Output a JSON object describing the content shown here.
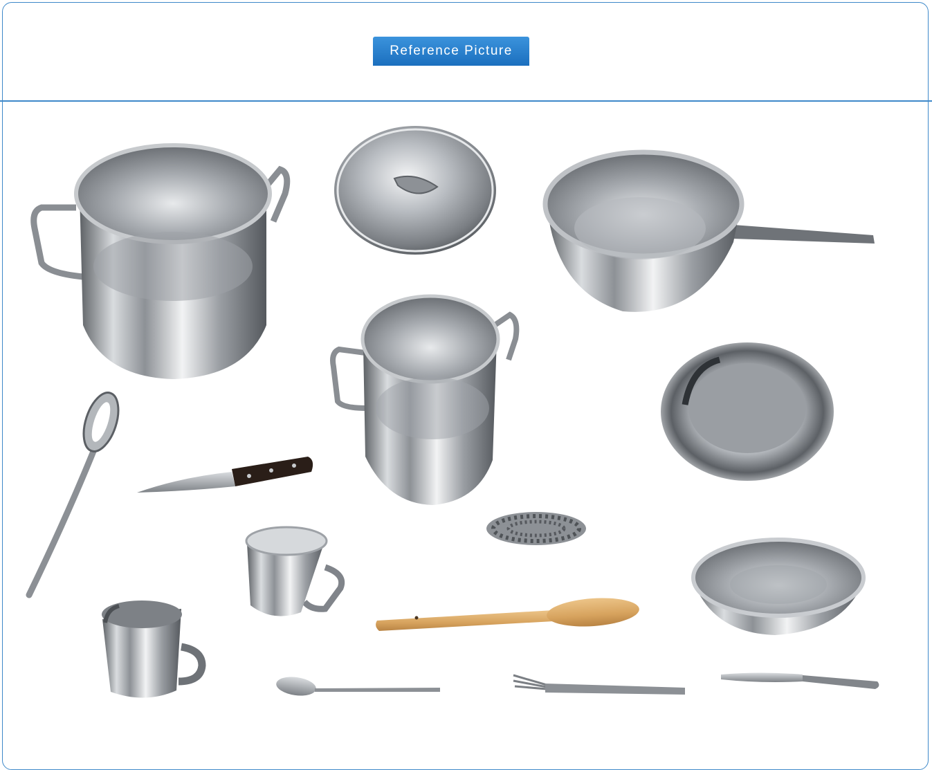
{
  "header": {
    "label": "Reference Picture"
  },
  "items": [
    "large-stock-pot",
    "pot-lid",
    "frying-pan",
    "medium-stock-pot",
    "slotted-serving-spoon",
    "kitchen-knife",
    "plate",
    "steel-wool-scrubber",
    "small-cup",
    "wooden-spoon",
    "bowl",
    "mug",
    "teaspoon",
    "fork",
    "table-knife"
  ],
  "colors": {
    "frame": "#3d88c9",
    "label_bg": "#1b6fbe",
    "label_text": "#ffffff"
  }
}
